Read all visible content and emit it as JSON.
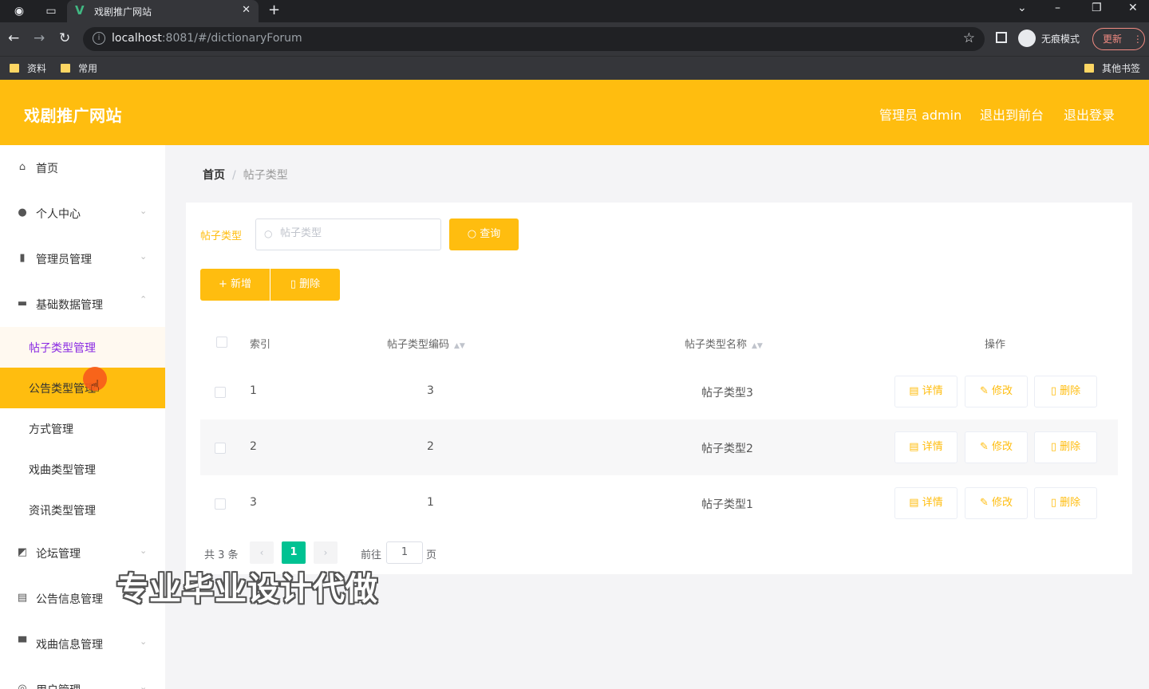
{
  "browser": {
    "tab_title": "戏剧推广网站",
    "url_host": "localhost",
    "url_rest": ":8081/#/dictionaryForum",
    "incognito_label": "无痕模式",
    "update_label": "更新",
    "bookmarks": [
      "资料",
      "常用"
    ],
    "other_bookmarks": "其他书签"
  },
  "header": {
    "brand": "戏剧推广网站",
    "admin": "管理员 admin",
    "to_front": "退出到前台",
    "logout": "退出登录"
  },
  "sidebar": {
    "items": [
      {
        "label": "首页",
        "icon": "home-icon"
      },
      {
        "label": "个人中心",
        "icon": "user-icon"
      },
      {
        "label": "管理员管理",
        "icon": "bar-chart-icon"
      },
      {
        "label": "基础数据管理",
        "icon": "monitor-icon"
      },
      {
        "label": "论坛管理",
        "icon": "chart-icon"
      },
      {
        "label": "公告信息管理",
        "icon": "document-icon"
      },
      {
        "label": "戏曲信息管理",
        "icon": "podium-icon"
      },
      {
        "label": "用户管理",
        "icon": "user-circle-icon"
      }
    ],
    "sub_items": [
      "帖子类型管理",
      "公告类型管理",
      "方式管理",
      "戏曲类型管理",
      "资讯类型管理"
    ]
  },
  "breadcrumb": {
    "home": "首页",
    "separator": "/",
    "current": "帖子类型"
  },
  "search": {
    "label": "帖子类型",
    "placeholder": "帖子类型",
    "query_button": "查询"
  },
  "actions": {
    "add": "新增",
    "delete": "删除"
  },
  "table": {
    "columns": [
      "索引",
      "帖子类型编码",
      "帖子类型名称",
      "操作"
    ],
    "rows": [
      {
        "index": "1",
        "code": "3",
        "name": "帖子类型3"
      },
      {
        "index": "2",
        "code": "2",
        "name": "帖子类型2"
      },
      {
        "index": "3",
        "code": "1",
        "name": "帖子类型1"
      }
    ],
    "row_actions": {
      "detail": "详情",
      "edit": "修改",
      "delete": "删除"
    }
  },
  "pagination": {
    "total": "共 3 条",
    "current_page": "1",
    "goto_label": "前往",
    "goto_value": "1",
    "page_suffix": "页"
  },
  "watermark": "专业毕业设计代做",
  "colors": {
    "accent": "#ffbd0f",
    "pagination_active": "#00c292",
    "active_submenu_text": "#8a2be2"
  }
}
